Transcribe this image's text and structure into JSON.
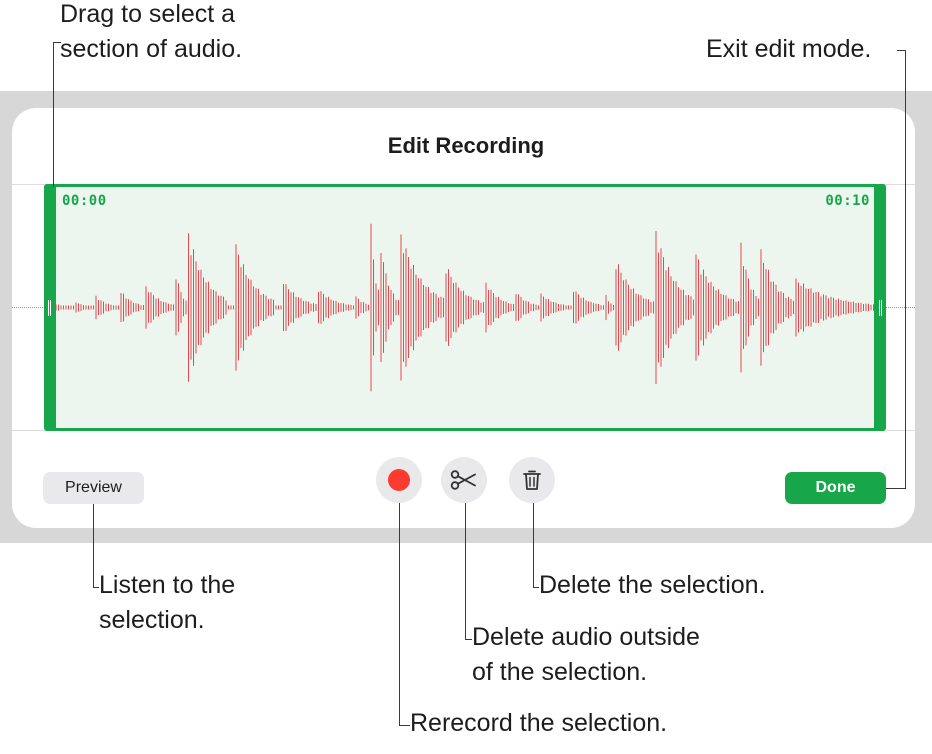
{
  "dialog": {
    "title": "Edit Recording",
    "selection_start_time": "00:00",
    "selection_end_time": "00:10"
  },
  "buttons": {
    "preview_label": "Preview",
    "done_label": "Done",
    "record_icon": "record-icon",
    "trim_icon": "scissors-icon",
    "delete_icon": "trash-icon"
  },
  "callouts": {
    "drag": "Drag to select a\nsection of audio.",
    "exit": "Exit edit mode.",
    "listen": "Listen to the\nselection.",
    "delete_selection": "Delete the selection.",
    "delete_outside": "Delete audio outside\nof the selection.",
    "rerecord": "Rerecord the selection."
  },
  "colors": {
    "accent": "#17a74a",
    "waveform": "#e5484d",
    "record": "#ff3b30",
    "band": "#d7d7d7"
  }
}
